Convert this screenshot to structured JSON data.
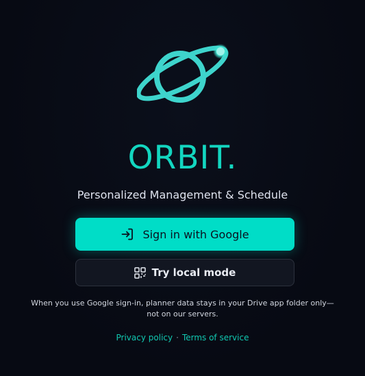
{
  "app": {
    "name": "ORBIT.",
    "tagline": "Personalized Management & Schedule",
    "logo_icon": "planet-orbit-icon",
    "accent_color": "#00ddc7"
  },
  "actions": {
    "google_signin": {
      "label": "Sign in with Google",
      "icon": "sign-in-icon"
    },
    "local_mode": {
      "label": "Try local mode",
      "icon": "grid-icon"
    }
  },
  "notice": {
    "text": "When you use Google sign-in, planner data stays in your Drive app folder only—not on our servers."
  },
  "footer": {
    "privacy_label": "Privacy policy",
    "separator": "·",
    "terms_label": "Terms of service"
  }
}
